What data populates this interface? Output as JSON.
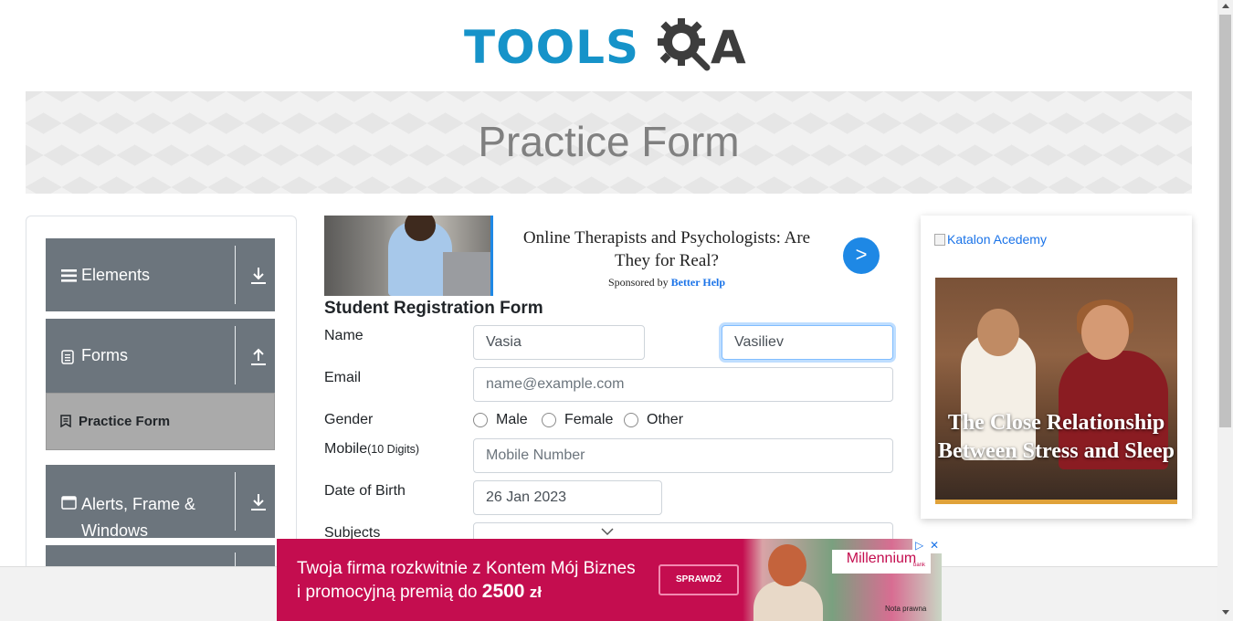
{
  "header": {
    "logo_text_tools": "TOOLS",
    "logo_text_a": "A",
    "page_title": "Practice Form"
  },
  "sidebar": {
    "groups": [
      {
        "label": "Elements",
        "icon": "hamburger-icon",
        "arrow": "download-arrow-icon"
      },
      {
        "label": "Forms",
        "icon": "document-icon",
        "arrow": "upload-arrow-icon",
        "items": [
          {
            "label": "Practice Form",
            "icon": "form-icon",
            "active": true
          }
        ]
      },
      {
        "label": "Alerts, Frame & Windows",
        "icon": "window-icon",
        "arrow": "download-arrow-icon"
      }
    ]
  },
  "ad_top": {
    "headline": "Online Therapists and Psychologists: Are They for Real?",
    "sponsor_prefix": "Sponsored by",
    "sponsor_name": "Better Help",
    "go_label": ">"
  },
  "form": {
    "title": "Student Registration Form",
    "name_label": "Name",
    "first_name_value": "Vasia",
    "last_name_value": "Vasiliev",
    "email_label": "Email",
    "email_placeholder": "name@example.com",
    "gender_label": "Gender",
    "gender_options": [
      "Male",
      "Female",
      "Other"
    ],
    "mobile_label": "Mobile",
    "mobile_hint": "(10 Digits)",
    "mobile_placeholder": "Mobile Number",
    "dob_label": "Date of Birth",
    "dob_value": "26 Jan 2023",
    "subjects_label": "Subjects"
  },
  "ad_right": {
    "broken_image_alt": "Katalon Acedemy",
    "headline": "The Close Relationship Between Stress and Sleep"
  },
  "ad_bottom": {
    "line1": "Twoja firma rozkwitnie z Kontem Mój Biznes",
    "line2_prefix": "i promocyjną premią do",
    "line2_amount": "2500",
    "line2_suffix": "zł",
    "button": "SPRAWDŹ",
    "brand": "Millennium",
    "brand_sub": "bank",
    "note": "Nota prawna",
    "adchoices": "▷",
    "close": "✕"
  },
  "colors": {
    "sidebar_group_bg": "#6c757d",
    "sidebar_active_bg": "#aaaaaa",
    "logo_blue": "#1693c9",
    "logo_dark": "#3d3d3d",
    "ad_pink": "#c40d4f"
  }
}
